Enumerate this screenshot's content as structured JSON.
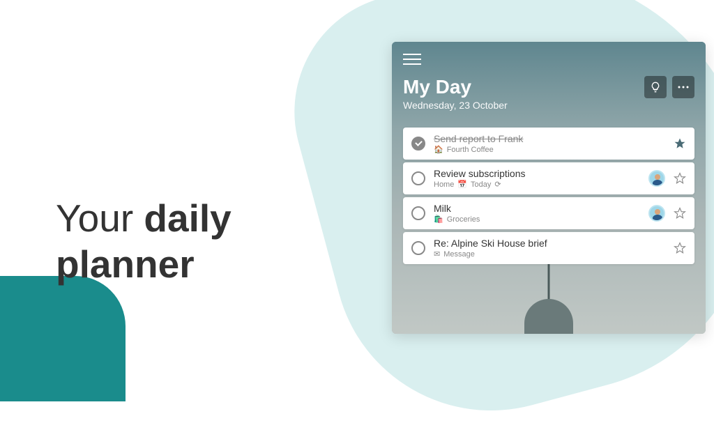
{
  "headline": {
    "line1_light": "Your",
    "line1_bold": "daily",
    "line2_bold": "planner"
  },
  "app": {
    "title": "My Day",
    "date": "Wednesday, 23 October"
  },
  "tasks": [
    {
      "title": "Send report to Frank",
      "completed": true,
      "starred": true,
      "meta_icon": "🏠",
      "meta_text": "Fourth Coffee",
      "has_avatar": false
    },
    {
      "title": "Review subscriptions",
      "completed": false,
      "starred": false,
      "meta_prefix": "Home",
      "meta_icon": "📅",
      "meta_text": "Today",
      "has_repeat": true,
      "has_avatar": true
    },
    {
      "title": "Milk",
      "completed": false,
      "starred": false,
      "meta_icon": "🛍️",
      "meta_text": "Groceries",
      "has_avatar": true
    },
    {
      "title": "Re: Alpine Ski House brief",
      "completed": false,
      "starred": false,
      "meta_icon": "✉",
      "meta_text": "Message",
      "has_avatar": false
    }
  ]
}
